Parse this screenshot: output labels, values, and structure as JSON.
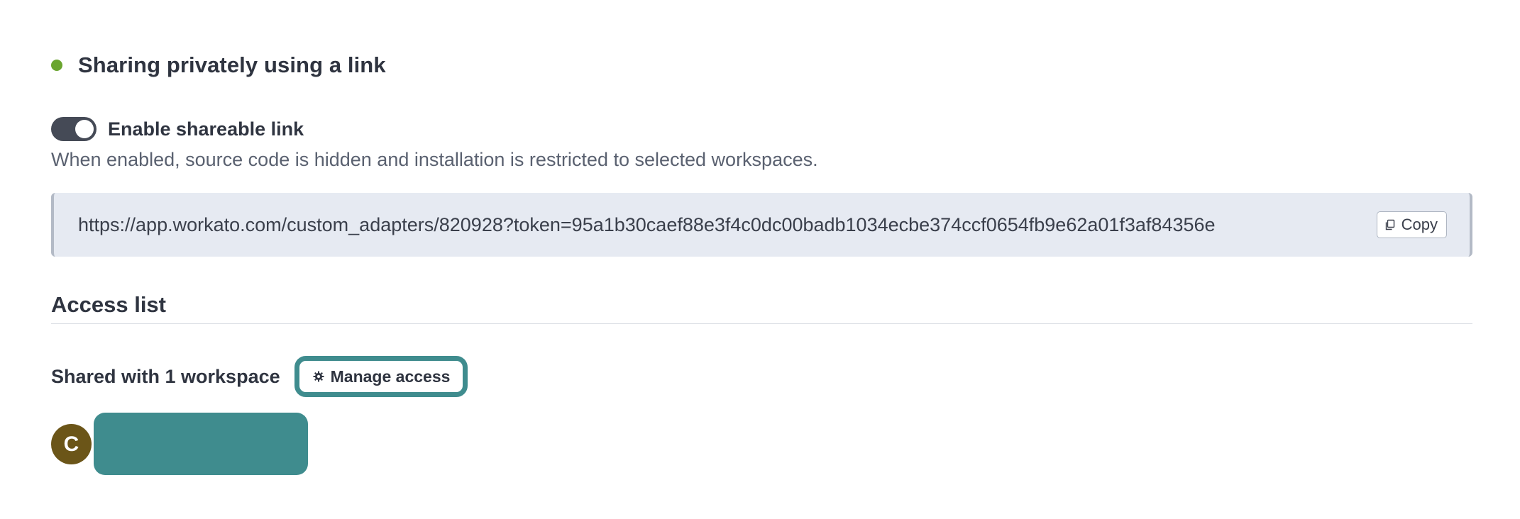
{
  "sharing": {
    "title": "Sharing privately using a link",
    "status_color": "#6aa52f"
  },
  "shareable_link": {
    "toggle_label": "Enable shareable link",
    "enabled": true,
    "help_text": "When enabled, source code is hidden and installation is restricted to selected workspaces.",
    "url": "https://app.workato.com/custom_adapters/820928?token=95a1b30caef88e3f4c0dc00badb1034ecbe374ccf0654fb9e62a01f3af84356e",
    "copy_label": "Copy",
    "copy_icon": "copy-icon"
  },
  "access_list": {
    "title": "Access list",
    "shared_text": "Shared with 1 workspace",
    "manage_label": "Manage access",
    "manage_icon": "gear-icon",
    "workspaces": [
      {
        "avatar_initial": "C",
        "avatar_color": "#6b5518",
        "name_chip_color": "#3f8c8e"
      }
    ]
  },
  "colors": {
    "accent": "#3f8c8e",
    "toggle_on": "#454a56",
    "link_box_bg": "#e6eaf2"
  }
}
